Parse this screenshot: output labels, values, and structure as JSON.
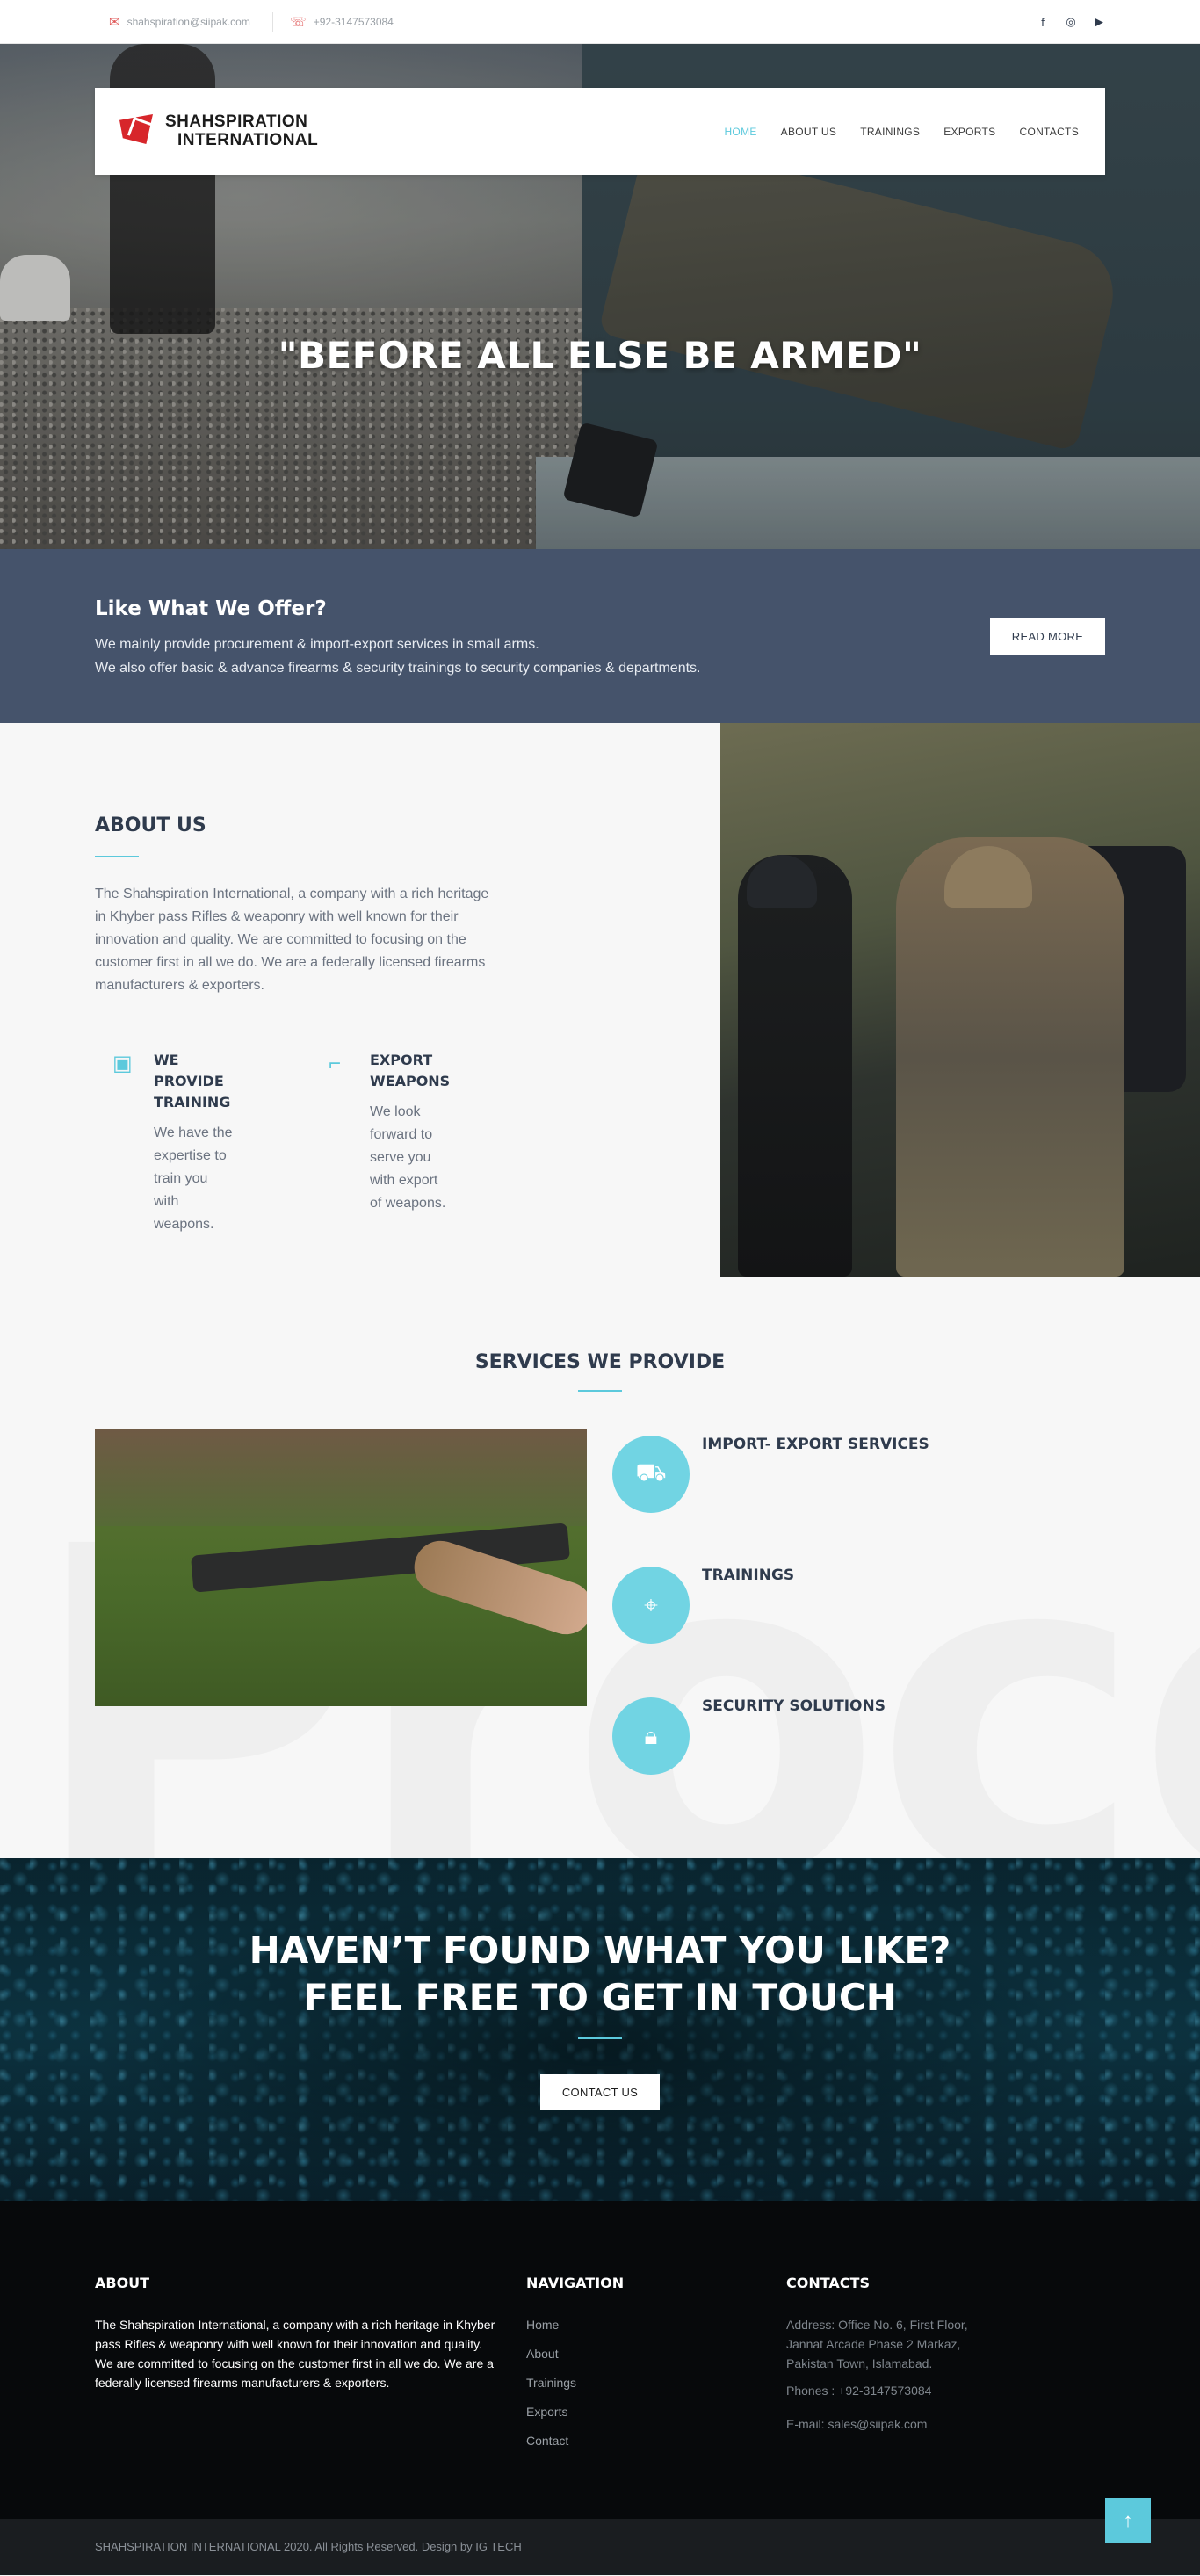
{
  "topbar": {
    "email": "shahspiration@siipak.com",
    "phone": "+92-3147573084",
    "social_icons": [
      "facebook-icon",
      "instagram-icon",
      "youtube-icon"
    ]
  },
  "header": {
    "logo_line1": "SHAHSPIRATION",
    "logo_line2": "INTERNATIONAL",
    "menu": [
      "HOME",
      "ABOUT US",
      "TRAININGS",
      "EXPORTS",
      "CONTACTS"
    ],
    "active_item": "HOME"
  },
  "hero": {
    "title": "\"BEFORE ALL ELSE BE ARMED\""
  },
  "offer": {
    "title": "Like What We Offer?",
    "line1": "We mainly provide procurement & import-export services in small arms.",
    "line2": "We also offer basic & advance firearms & security trainings to security companies & departments.",
    "button": "READ MORE"
  },
  "about": {
    "title": "ABOUT US",
    "description": "The Shahspiration International, a company with a rich heritage in Khyber pass Rifles & weaponry with well known for their innovation and quality. We are committed to focusing on the customer first in all we do. We are a federally licensed firearms manufacturers & exporters.",
    "features": [
      {
        "title": "WE PROVIDE TRAINING",
        "text": "We have the expertise to train you with weapons."
      },
      {
        "title": "EXPORT WEAPONS",
        "text": "We look forward to serve you with export of weapons."
      }
    ]
  },
  "services": {
    "title": "SERVICES WE PROVIDE",
    "bg_word": "Proce",
    "items": [
      {
        "title": "IMPORT- EXPORT SERVICES",
        "icon": "cart-icon"
      },
      {
        "title": "TRAININGS",
        "icon": "target-icon"
      },
      {
        "title": "SECURITY SOLUTIONS",
        "icon": "lock-icon"
      }
    ]
  },
  "cta": {
    "line1": "HAVEN’T FOUND WHAT YOU LIKE?",
    "line2": "FEEL FREE TO GET IN TOUCH",
    "button": "CONTACT US"
  },
  "footer": {
    "about_title": "ABOUT",
    "about_text": "The Shahspiration International, a company with a rich heritage in Khyber pass Rifles & weaponry with well known for their innovation and quality. We are committed to focusing on the customer first in all we do. We are a federally licensed firearms manufacturers & exporters.",
    "nav_title": "NAVIGATION",
    "nav": [
      "Home",
      "About",
      "Trainings",
      "Exports",
      "Contact"
    ],
    "contacts_title": "CONTACTS",
    "address": "Address:  Office No. 6, First Floor, Jannat Arcade Phase 2 Markaz, Pakistan Town, Islamabad.",
    "phones": "Phones :  +92-3147573084",
    "email": "E-mail:  sales@siipak.com"
  },
  "bottom": {
    "copyright": "SHAHSPIRATION INTERNATIONAL 2020. All Rights Reserved. Design by IG TECH"
  },
  "colors": {
    "accent": "#5cc9dc",
    "offer_band": "#45536b",
    "heading": "#2f3b4d"
  }
}
